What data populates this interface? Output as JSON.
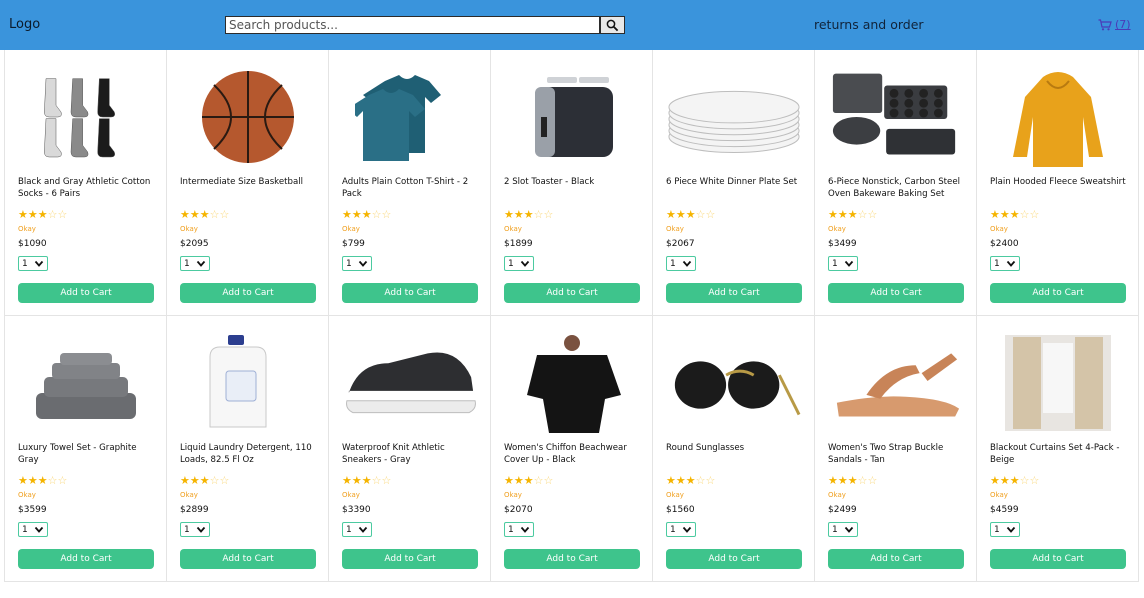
{
  "header": {
    "logo": "Logo",
    "search_placeholder": "Search products...",
    "returns_label": "returns and order",
    "cart_count": "(7)",
    "bg_color": "#3a94dc"
  },
  "products": [
    {
      "name": "Black and Gray Athletic Cotton Socks - 6 Pairs",
      "stars": 3,
      "rating_label": "Okay",
      "price": "$1090",
      "qty": "1",
      "button": "Add to Cart",
      "image": "socks"
    },
    {
      "name": "Intermediate Size Basketball",
      "stars": 3,
      "rating_label": "Okay",
      "price": "$2095",
      "qty": "1",
      "button": "Add to Cart",
      "image": "basketball"
    },
    {
      "name": "Adults Plain Cotton T-Shirt - 2 Pack",
      "stars": 3,
      "rating_label": "Okay",
      "price": "$799",
      "qty": "1",
      "button": "Add to Cart",
      "image": "tshirt"
    },
    {
      "name": "2 Slot Toaster - Black",
      "stars": 3,
      "rating_label": "Okay",
      "price": "$1899",
      "qty": "1",
      "button": "Add to Cart",
      "image": "toaster"
    },
    {
      "name": "6 Piece White Dinner Plate Set",
      "stars": 3,
      "rating_label": "Okay",
      "price": "$2067",
      "qty": "1",
      "button": "Add to Cart",
      "image": "plates"
    },
    {
      "name": "6-Piece Nonstick, Carbon Steel Oven Bakeware Baking Set",
      "stars": 3,
      "rating_label": "Okay",
      "price": "$3499",
      "qty": "1",
      "button": "Add to Cart",
      "image": "bakeware"
    },
    {
      "name": "Plain Hooded Fleece Sweatshirt",
      "stars": 3,
      "rating_label": "Okay",
      "price": "$2400",
      "qty": "1",
      "button": "Add to Cart",
      "image": "hoodie"
    },
    {
      "name": "Luxury Towel Set - Graphite Gray",
      "stars": 3,
      "rating_label": "Okay",
      "price": "$3599",
      "qty": "1",
      "button": "Add to Cart",
      "image": "towels"
    },
    {
      "name": "Liquid Laundry Detergent, 110 Loads, 82.5 Fl Oz",
      "stars": 3,
      "rating_label": "Okay",
      "price": "$2899",
      "qty": "1",
      "button": "Add to Cart",
      "image": "detergent"
    },
    {
      "name": "Waterproof Knit Athletic Sneakers - Gray",
      "stars": 3,
      "rating_label": "Okay",
      "price": "$3390",
      "qty": "1",
      "button": "Add to Cart",
      "image": "sneaker"
    },
    {
      "name": "Women's Chiffon Beachwear Cover Up - Black",
      "stars": 3,
      "rating_label": "Okay",
      "price": "$2070",
      "qty": "1",
      "button": "Add to Cart",
      "image": "coverup"
    },
    {
      "name": "Round Sunglasses",
      "stars": 3,
      "rating_label": "Okay",
      "price": "$1560",
      "qty": "1",
      "button": "Add to Cart",
      "image": "sunglasses"
    },
    {
      "name": "Women's Two Strap Buckle Sandals - Tan",
      "stars": 3,
      "rating_label": "Okay",
      "price": "$2499",
      "qty": "1",
      "button": "Add to Cart",
      "image": "sandal"
    },
    {
      "name": "Blackout Curtains Set 4-Pack - Beige",
      "stars": 3,
      "rating_label": "Okay",
      "price": "$4599",
      "qty": "1",
      "button": "Add to Cart",
      "image": "curtains"
    }
  ]
}
